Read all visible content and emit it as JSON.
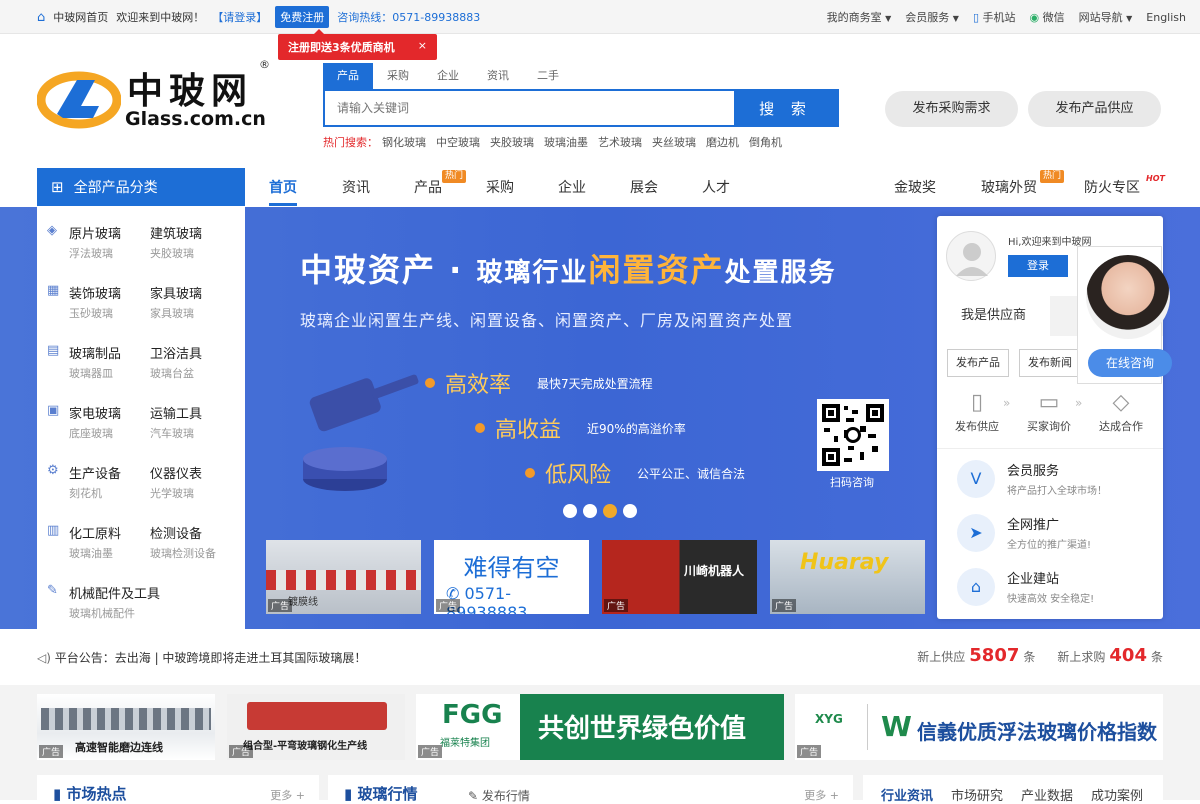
{
  "topbar": {
    "home": "中玻网首页",
    "welcome": "欢迎来到中玻网！",
    "login": "【请登录】",
    "register": "免费注册",
    "hotline": "咨询热线：0571-89938883",
    "right_links": [
      "我的商务室",
      "会员服务",
      "手机站",
      "微信",
      "网站导航",
      "English"
    ]
  },
  "register_tip": {
    "text": "注册即送3条优质商机",
    "close": "×"
  },
  "logo": {
    "cn": "中玻网",
    "en": "Glass.com.cn",
    "reg": "®"
  },
  "search": {
    "tabs": [
      "产品",
      "采购",
      "企业",
      "资讯",
      "二手"
    ],
    "placeholder": "请输入关键词",
    "button": "搜 索",
    "hot_label": "热门搜索：",
    "hot_terms": [
      "钢化玻璃",
      "中空玻璃",
      "夹胶玻璃",
      "玻璃油墨",
      "艺术玻璃",
      "夹丝玻璃",
      "磨边机",
      "倒角机"
    ]
  },
  "header_buttons": {
    "purchase": "发布采购需求",
    "supply": "发布产品供应"
  },
  "nav": {
    "all_categories": "全部产品分类",
    "items": [
      "首页",
      "资讯",
      "产品",
      "采购",
      "企业",
      "展会",
      "人才",
      "金玻奖",
      "玻璃外贸",
      "防火专区"
    ],
    "badge_hot": "热门",
    "badge_hot_en": "HOT"
  },
  "categories": [
    {
      "a": "原片玻璃",
      "b": "建筑玻璃",
      "c": "浮法玻璃",
      "d": "夹胶玻璃",
      "icon": "glass-sheet-icon"
    },
    {
      "a": "装饰玻璃",
      "b": "家具玻璃",
      "c": "玉砂玻璃",
      "d": "家具玻璃",
      "icon": "building-icon"
    },
    {
      "a": "玻璃制品",
      "b": "卫浴洁具",
      "c": "玻璃器皿",
      "d": "玻璃台盆",
      "icon": "window-icon"
    },
    {
      "a": "家电玻璃",
      "b": "运输工具",
      "c": "底座玻璃",
      "d": "汽车玻璃",
      "icon": "car-icon"
    },
    {
      "a": "生产设备",
      "b": "仪器仪表",
      "c": "刻花机",
      "d": "光学玻璃",
      "icon": "gear-icon"
    },
    {
      "a": "化工原料",
      "b": "检测设备",
      "c": "玻璃油墨",
      "d": "玻璃检测设备",
      "icon": "chart-icon"
    },
    {
      "a": "机械配件及工具",
      "b": "",
      "c": "玻璃机械配件",
      "d": "",
      "icon": "wrench-icon"
    }
  ],
  "banner": {
    "title_a": "中玻资产",
    "title_dot": "·",
    "title_b": "玻璃行业",
    "title_highlight": "闲置资产",
    "title_c": "处置服务",
    "subtitle": "玻璃企业闲置生产线、闲置设备、闲置资产、厂房及闲置资产处置",
    "features": [
      {
        "title": "高效率",
        "desc": "最快7天完成处置流程"
      },
      {
        "title": "高收益",
        "desc": "近90%的高溢价率"
      },
      {
        "title": "低风险",
        "desc": "公平公正、诚信合法"
      }
    ],
    "qr_label": "扫码咨询",
    "active_dot": 2
  },
  "banner_ads": [
    {
      "label": "镀膜线",
      "tag": "广告"
    },
    {
      "label": "难得有空",
      "phone": "0571-89938883",
      "tag": "广告"
    },
    {
      "label": "川崎机器人",
      "tag": "广告"
    },
    {
      "label": "Huaray",
      "tag": "广告"
    }
  ],
  "user_panel": {
    "greeting": "Hi,欢迎来到中玻网",
    "login": "登录",
    "tab_supplier": "我是供应商",
    "tab_buyer": "我",
    "btn_product": "发布产品",
    "btn_news": "发布新闻",
    "steps": [
      "发布供应",
      "买家询价",
      "达成合作"
    ],
    "services": [
      {
        "title": "会员服务",
        "desc": "将产品打入全球市场！",
        "icon": "vip-icon"
      },
      {
        "title": "全网推广",
        "desc": "全方位的推广渠道!",
        "icon": "send-icon"
      },
      {
        "title": "企业建站",
        "desc": "快速高效 安全稳定!",
        "icon": "store-icon"
      }
    ]
  },
  "advisor": {
    "button": "在线咨询"
  },
  "notice": {
    "text": "平台公告：去出海 | 中玻跨境即将走进土耳其国际玻璃展！",
    "supply_label": "新上供应",
    "supply_count": "5807",
    "demand_label": "新上求购",
    "demand_count": "404",
    "unit": "条"
  },
  "bottom_ads": [
    {
      "label": "高速智能磨边连线",
      "tag": "广告"
    },
    {
      "label": "组合型-平弯玻璃钢化生产线",
      "tag": "广告"
    },
    {
      "label": "共创世界绿色价值",
      "brand": "FGG",
      "brand_cn": "福莱特集团",
      "tag": "广告"
    },
    {
      "label": "信義优质浮法玻璃价格指数",
      "brand": "XYG",
      "tag": "广告"
    }
  ],
  "sections": {
    "market_hot": "市场热点",
    "glass_market": "玻璃行情",
    "publish_market": "发布行情",
    "more": "更多 +",
    "news_tabs": [
      "行业资讯",
      "市场研究",
      "产业数据",
      "成功案例"
    ]
  },
  "colors": {
    "brand": "#1d6ed6",
    "accent": "#e3282b",
    "orange": "#f0a92b"
  }
}
